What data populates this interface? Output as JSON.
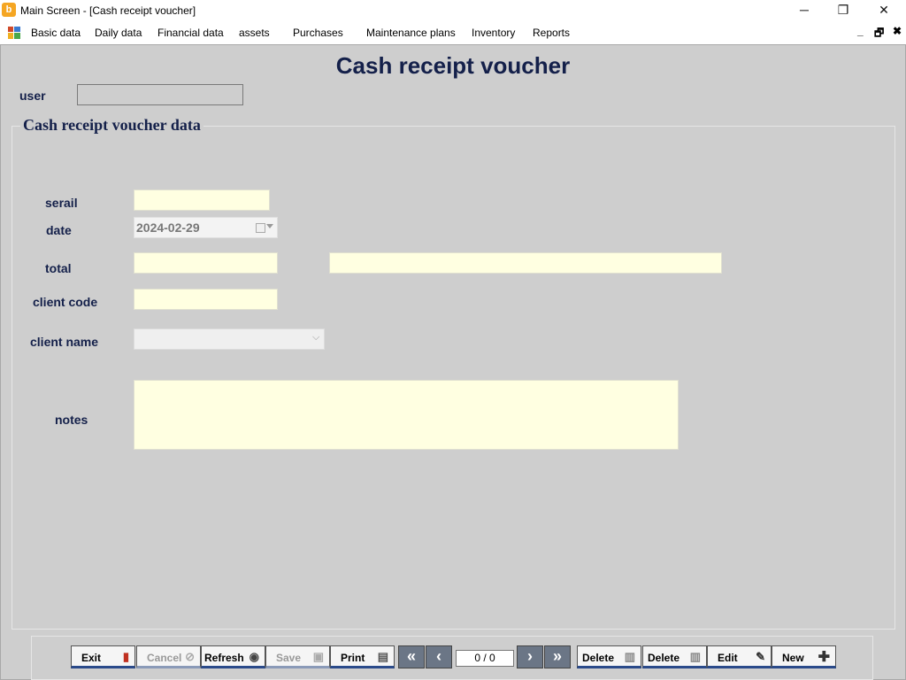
{
  "window": {
    "title": "Main Screen - [Cash receipt voucher]",
    "app_icon": "b",
    "minimize": "─",
    "restore": "❐",
    "close": "✕"
  },
  "menu": {
    "items": [
      "Basic data",
      "Daily data",
      "Financial data",
      "assets",
      "Purchases",
      "Maintenance plans",
      "Inventory",
      "Reports"
    ],
    "mdi_min": "_",
    "mdi_restore": "🗗",
    "mdi_close": "✖"
  },
  "form": {
    "title": "Cash receipt voucher",
    "user_label": "user",
    "user_value": "",
    "group_title": "Cash receipt voucher data",
    "serial_label": "serail",
    "serial_value": "",
    "date_label": "date",
    "date_value": "2024-02-29",
    "total_label": "total",
    "total_value": "",
    "total_words": "",
    "client_code_label": "client code",
    "client_code_value": "",
    "client_name_label": "client name",
    "client_name_value": "",
    "notes_label": "notes",
    "notes_value": ""
  },
  "toolbar": {
    "exit": "Exit",
    "cancel": "Cancel",
    "refresh": "Refresh",
    "save": "Save",
    "print": "Print",
    "first": "«",
    "prev": "‹",
    "pager": "0 / 0",
    "next": "›",
    "last": "»",
    "delete1": "Delete",
    "delete2": "Delete",
    "edit": "Edit",
    "new": "New"
  },
  "colors": {
    "background": "#cecece",
    "heading": "#14204a",
    "input": "#ffffe1",
    "button_accent": "#2a4a8a"
  },
  "icons": {
    "exit": "exit-door-icon",
    "cancel": "cancel-circle-icon",
    "refresh": "refresh-icon",
    "save": "floppy-disk-icon",
    "print": "printer-icon",
    "delete": "trash-icon",
    "edit": "pencil-icon",
    "new": "plus-icon"
  }
}
